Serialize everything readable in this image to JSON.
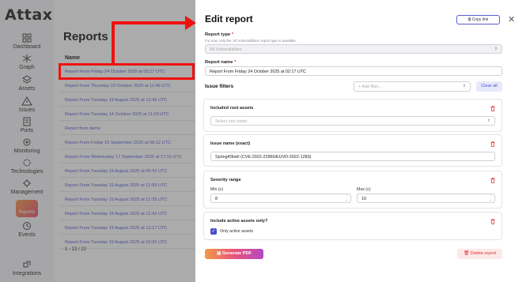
{
  "app": {
    "logo": "Attaxion"
  },
  "sidebar": {
    "items": [
      {
        "label": "Dashboard",
        "icon": "dashboard-icon"
      },
      {
        "label": "Graph",
        "icon": "graph-icon"
      },
      {
        "label": "Assets",
        "icon": "assets-icon"
      },
      {
        "label": "Issues",
        "icon": "issues-icon"
      },
      {
        "label": "Ports",
        "icon": "ports-icon"
      },
      {
        "label": "Monitoring",
        "icon": "monitoring-icon"
      },
      {
        "label": "Technologies",
        "icon": "technologies-icon"
      },
      {
        "label": "Management",
        "icon": "management-icon"
      },
      {
        "label": "Reports",
        "icon": "reports-icon"
      },
      {
        "label": "Events",
        "icon": "events-icon"
      },
      {
        "label": "Integrations",
        "icon": "integrations-icon"
      }
    ]
  },
  "reports": {
    "title": "Reports",
    "column": "Name",
    "rows": [
      "Report From Friday 24 October 2025 at 02:17 UTC",
      "Report From Thursday 23 October 2025 at 11:46 UTC",
      "Report From Tuesday 19 August 2025 at 13:45 UTC",
      "Report From Tuesday 14 October 2025 at 11:03 UTC",
      "Report from demo",
      "Report From Friday 15 September 2025 at 06:12 UTC",
      "Report From Wednesday 17 September 2025 at 17:16 UTC",
      "Report From Tuesday 19 August 2025 at 09:42 UTC",
      "Report From Tuesday 19 August 2025 at 12:59 UTC",
      "Report From Tuesday 19 August 2025 at 12:35 UTC",
      "Report From Tuesday 19 August 2025 at 12:42 UTC",
      "Report From Tuesday 19 August 2025 at 13:17 UTC",
      "Report From Tuesday 19 August 2025 at 10:30 UTC"
    ],
    "pager": "1 - 22 / 22"
  },
  "drawer": {
    "title": "Edit report",
    "copy_link": "Copy link",
    "report_type_label": "Report type",
    "report_type_hint": "For now, only the 'All Vulnerabilities' report type is available.",
    "report_type_value": "All Vulnerabilities",
    "report_name_label": "Report name",
    "report_name_value": "Report From Friday 24 October 2025 at 02:17 UTC",
    "issue_filters": "Issue filters",
    "add_filter_placeholder": "Add filter...",
    "clear_all": "Clear all",
    "root_assets": {
      "title": "Included root assets",
      "placeholder": "Select root asset"
    },
    "issue_name": {
      "title": "Issue name (exact)",
      "value": "Spring4Shell (CVE-2022-22965/EUVD-2022-1283)"
    },
    "severity": {
      "title": "Severity range",
      "min_label": "Min (≥)",
      "min_value": "8",
      "max_label": "Max (≤)",
      "max_value": "10"
    },
    "active_assets": {
      "title": "Include active assets only?",
      "checkbox_label": "Only active assets",
      "checked": true
    },
    "generate": "Generate PDF",
    "delete": "Delete report"
  }
}
